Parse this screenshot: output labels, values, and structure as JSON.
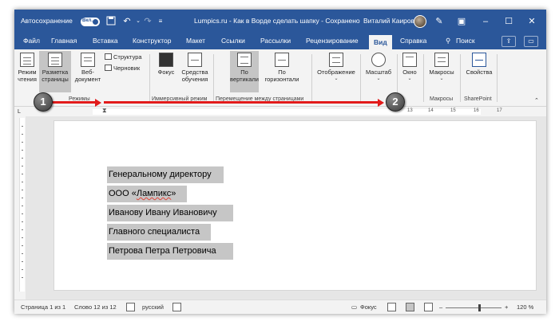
{
  "titlebar": {
    "autosave_label": "Автосохранение",
    "autosave_state": "Вкл.",
    "document_title": "Lumpics.ru - Как в Ворде сделать шапку - Сохранено",
    "user_name": "Виталий Каиров"
  },
  "menu": {
    "items": [
      "Файл",
      "Главная",
      "Вставка",
      "Конструктор",
      "Макет",
      "Ссылки",
      "Рассылки",
      "Рецензирование",
      "Вид",
      "Справка"
    ],
    "active": "Вид",
    "search": "Поиск"
  },
  "ribbon": {
    "reading_mode": "Режим чтения",
    "print_layout": "Разметка страницы",
    "web_layout": "Веб-документ",
    "outline": "Структура",
    "draft": "Черновик",
    "group_modes": "Режимы",
    "focus": "Фокус",
    "learning_tools": "Средства обучения",
    "group_immersive": "Иммерсивный режим",
    "vertical": "По вертикали",
    "side_to_side": "По горизонтали",
    "group_page_movement": "Перемещение между страницами",
    "show": "Отображение",
    "zoom": "Масштаб",
    "window": "Окно",
    "macros": "Макросы",
    "group_macros": "Макросы",
    "properties": "Свойства",
    "group_sharepoint": "SharePoint"
  },
  "ruler": {
    "ticks": [
      "13",
      "14",
      "15",
      "16",
      "17"
    ]
  },
  "callouts": {
    "first": "1",
    "second": "2"
  },
  "document": {
    "lines": [
      "Генеральному директору",
      "ООО «Лампикс»",
      "Иванову Ивану Ивановичу",
      "Главного специалиста",
      "Петрова Петра Петровича"
    ],
    "line2_prefix": "ООО «",
    "line2_word": "Лампикс",
    "line2_suffix": "»"
  },
  "status": {
    "page": "Страница 1 из 1",
    "words": "Слово 12 из 12",
    "language": "русский",
    "focus": "Фокус",
    "zoom_level": "120 %"
  },
  "colors": {
    "accent": "#2b579a",
    "arrow": "#e21b1b",
    "selection": "#c6c6c6"
  }
}
